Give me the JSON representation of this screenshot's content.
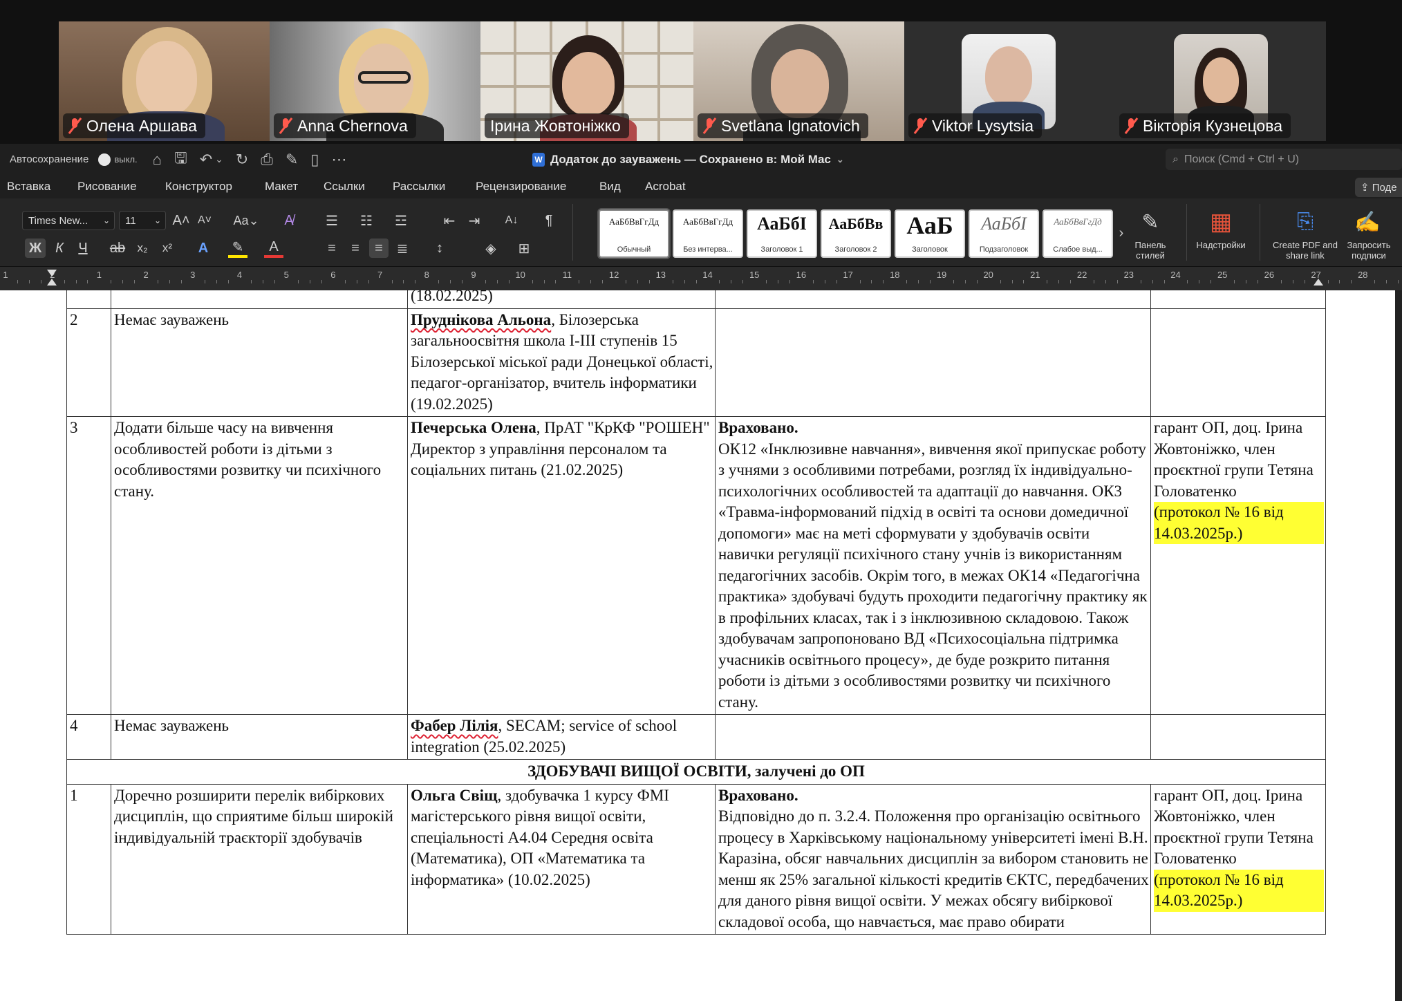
{
  "zoom": {
    "participants": [
      {
        "name": "Олена Аршава",
        "muted": true,
        "active": false
      },
      {
        "name": "Anna Chernova",
        "muted": true,
        "active": false
      },
      {
        "name": "Ірина Жовтоніжко",
        "muted": false,
        "active": true
      },
      {
        "name": "Svetlana Ignatovich",
        "muted": true,
        "active": false
      },
      {
        "name": "Viktor Lysytsia",
        "muted": true,
        "active": false
      },
      {
        "name": "Вікторія Кузнецова",
        "muted": true,
        "active": false
      }
    ],
    "active_speaker_color": "#35d36a"
  },
  "word": {
    "titlebar": {
      "autosave_label": "Автосохранение",
      "autosave_state": "выкл.",
      "doc_title": "Додаток до зауважень — Сохранено в: Мой Mac",
      "search_placeholder": "Поиск (Cmd + Ctrl + U)"
    },
    "tabs": [
      "Вставка",
      "Рисование",
      "Конструктор",
      "Макет",
      "Ссылки",
      "Рассылки",
      "Рецензирование",
      "Вид",
      "Acrobat"
    ],
    "share_label": "Поде",
    "ribbon": {
      "font_name": "Times New...",
      "font_size": "11",
      "bold": "Ж",
      "italic": "К",
      "underline": "Ч",
      "styles": [
        {
          "sample": "АаБбВвГгДд",
          "caption": "Обычный"
        },
        {
          "sample": "АаБбВвГгДд",
          "caption": "Без интерва..."
        },
        {
          "sample": "АаБбІ",
          "caption": "Заголовок 1"
        },
        {
          "sample": "АаБбВв",
          "caption": "Заголовок 2"
        },
        {
          "sample": "АаБ",
          "caption": "Заголовок"
        },
        {
          "sample": "АаБбІ",
          "caption": "Подзаголовок"
        },
        {
          "sample": "АаБбВвГгДд",
          "caption": "Слабое выд..."
        }
      ],
      "styles_pane": "Панель стилей",
      "addins": "Надстройки",
      "create_pdf": "Create PDF and share link",
      "request_sign": "Запросить подписи"
    },
    "ruler": [
      "1",
      "2",
      "1",
      "2",
      "3",
      "4",
      "5",
      "6",
      "7",
      "8",
      "9",
      "10",
      "11",
      "12",
      "13",
      "14",
      "15",
      "16",
      "17",
      "18",
      "19",
      "20",
      "21",
      "22",
      "23",
      "24",
      "25",
      "26",
      "27",
      "28"
    ]
  },
  "table": {
    "top_fragment": "(18.02.2025)",
    "rows_employers": [
      {
        "num": "2",
        "remark": "Немає зауважень",
        "author_name": "Пруднікова Альона",
        "author_rest": ", Білозерська загальноосвітня школа І-ІІІ ступенів 15 Білозерської міської ради Донецької області, педагог-організатор, вчитель інформатики (19.02.2025)",
        "response_lead": "",
        "response": "",
        "responsible": "",
        "protocol": ""
      },
      {
        "num": "3",
        "remark": "Додати більше часу на вивчення особливостей роботи із дітьми з особливостями розвитку чи психічного стану.",
        "author_name": "Печерська Олена",
        "author_rest": ", ПрАТ \"КрКФ \"РОШЕН\" Директор з управління персоналом та соціальних питань (21.02.2025)",
        "response_lead": "Враховано.",
        "response": "ОК12 «Інклюзивне навчання», вивчення якої припускає роботу з учнями з особливими потребами, розгляд їх індивідуально-психологічних особливостей та адаптації до навчання. ОК3 «Травма-інформований підхід в освіті та основи домедичної допомоги» має на меті сформувати у здобувачів освіти навички регуляції психічного стану учнів із використанням педагогічних засобів. Окрім того, в межах ОК14 «Педагогічна практика» здобувачі будуть проходити педагогічну практику як в профільних класах, так і з інклюзивною складовою. Також здобувачам запропоновано ВД «Психосоціальна підтримка учасників освітнього процесу», де буде розкрито питання роботи із дітьми з особливостями розвитку чи психічного стану.",
        "responsible": "гарант ОП, доц. Ірина Жовтоніжко, член проєктної групи Тетяна Головатенко",
        "protocol": "(протокол № 16 від 14.03.2025р.)"
      },
      {
        "num": "4",
        "remark": "Немає зауважень",
        "author_name": "Фабер Лілія",
        "author_rest": ", SECAM; service of school integration (25.02.2025)",
        "response_lead": "",
        "response": "",
        "responsible": "",
        "protocol": ""
      }
    ],
    "section_heading": "ЗДОБУВАЧІ ВИЩОЇ ОСВІТИ, залучені до ОП",
    "rows_students": [
      {
        "num": "1",
        "remark": "Доречно розширити перелік вибіркових дисциплін, що сприятиме більш широкій індивідуальній траєкторії здобувачів",
        "author_name": "Ольга Свіщ",
        "author_rest": ", здобувачка 1 курсу ФМІ магістерського рівня вищої освіти, спеціальності А4.04 Середня освіта (Математика), ОП «Математика та інформатика» (10.02.2025)",
        "response_lead": "Враховано.",
        "response": "Відповідно до п. 3.2.4. Положення про організацію освітнього процесу в Харківському національному університеті імені В.Н. Каразіна, обсяг навчальних дисциплін за вибором становить не менш як 25% загальної кількості кредитів ЄКТС, передбачених для даного рівня вищої освіти. У межах обсягу вибіркової складової особа, що навчається, має право обирати",
        "responsible": "гарант ОП, доц. Ірина Жовтоніжко, член проєктної групи Тетяна Головатенко",
        "protocol": "(протокол № 16 від 14.03.2025р.)"
      }
    ]
  }
}
